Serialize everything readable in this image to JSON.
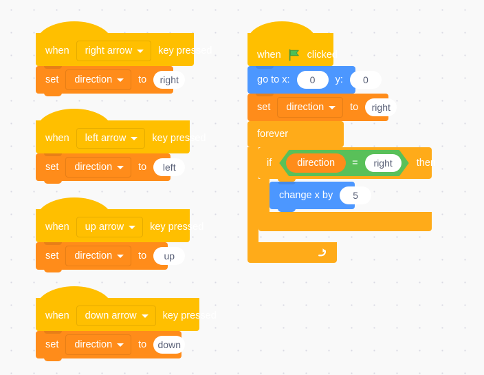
{
  "workspace": {
    "name": "scratch-block-workspace",
    "background_color": "#f9f9f9",
    "grid_dot_color": "#d9d9e3"
  },
  "palette_colors": {
    "events": "#ffbf00",
    "variables": "#ff8c1a",
    "motion": "#4c97ff",
    "control": "#ffab19",
    "operators": "#59c059",
    "field_text": "#575e75",
    "block_text": "#ffffff"
  },
  "scripts": [
    {
      "id": "script-right-arrow",
      "hat": {
        "prefix": "when",
        "dropdown_value": "right arrow",
        "suffix": "key pressed"
      },
      "set_block": {
        "prefix": "set",
        "variable": "direction",
        "connector": "to",
        "value": "right"
      }
    },
    {
      "id": "script-left-arrow",
      "hat": {
        "prefix": "when",
        "dropdown_value": "left arrow",
        "suffix": "key pressed"
      },
      "set_block": {
        "prefix": "set",
        "variable": "direction",
        "connector": "to",
        "value": "left"
      }
    },
    {
      "id": "script-up-arrow",
      "hat": {
        "prefix": "when",
        "dropdown_value": "up arrow",
        "suffix": "key pressed"
      },
      "set_block": {
        "prefix": "set",
        "variable": "direction",
        "connector": "to",
        "value": "up"
      }
    },
    {
      "id": "script-down-arrow",
      "hat": {
        "prefix": "when",
        "dropdown_value": "down arrow",
        "suffix": "key pressed"
      },
      "set_block": {
        "prefix": "set",
        "variable": "direction",
        "connector": "to",
        "value": "down"
      }
    }
  ],
  "main_script": {
    "id": "script-green-flag",
    "hat": {
      "prefix": "when",
      "icon": "green-flag-icon",
      "suffix": "clicked"
    },
    "go_to_xy": {
      "label_x": "go to x:",
      "value_x": "0",
      "label_y": "y:",
      "value_y": "0"
    },
    "set_block": {
      "prefix": "set",
      "variable": "direction",
      "connector": "to",
      "value": "right"
    },
    "forever": {
      "label": "forever",
      "loop_icon": "loop-arrow-icon"
    },
    "if_block": {
      "label_if": "if",
      "label_then": "then",
      "condition": {
        "left_operand": "direction",
        "operator": "=",
        "right_operand": "right"
      }
    },
    "change_x": {
      "label": "change x by",
      "value": "5"
    }
  }
}
